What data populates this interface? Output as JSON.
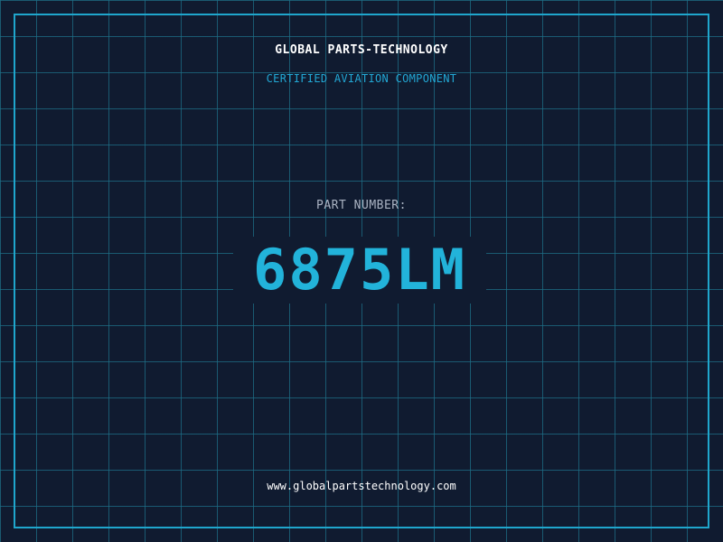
{
  "header": {
    "company": "GLOBAL PARTS-TECHNOLOGY",
    "tagline": "CERTIFIED AVIATION COMPONENT"
  },
  "part": {
    "label": "PART NUMBER:",
    "number": "6875LM"
  },
  "footer": {
    "website": "www.globalpartstechnology.com"
  },
  "colors": {
    "background": "#101b30",
    "grid": "#1e6e87",
    "accent": "#22b3da",
    "frame": "#1fa6cc"
  }
}
